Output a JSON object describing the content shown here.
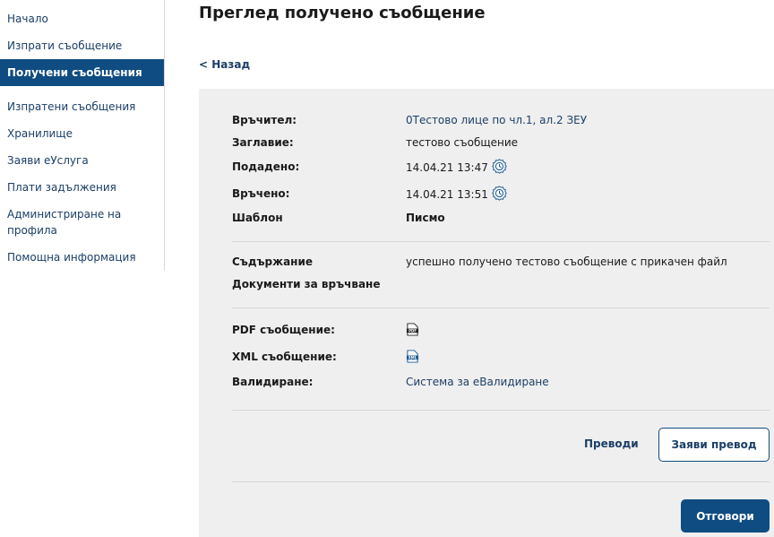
{
  "sidebar": {
    "items": [
      {
        "label": "Начало"
      },
      {
        "label": "Изпрати съобщение"
      },
      {
        "label": "Получени съобщения"
      },
      {
        "label": "Изпратени съобщения"
      },
      {
        "label": "Хранилище"
      },
      {
        "label": "Заяви еУслуга"
      },
      {
        "label": "Плати задължения"
      },
      {
        "label": "Администриране на профила"
      },
      {
        "label": "Помощна информация"
      }
    ],
    "admin_line1": "Администриране на",
    "admin_line2": "профила"
  },
  "header": {
    "title": "Преглед получено съобщение",
    "back": "< Назад"
  },
  "message": {
    "sender_label": "Връчител:",
    "sender_value": "0Тестово лице по чл.1, ал.2 ЗЕУ",
    "subject_label": "Заглавие:",
    "subject_value": "тестово съобщение",
    "submitted_label": "Подадено:",
    "submitted_value": "14.04.21 13:47",
    "delivered_label": "Връчено:",
    "delivered_value": "14.04.21 13:51",
    "template_label": "Шаблон",
    "template_value": "Писмо",
    "content_label": "Съдържание",
    "content_value": "успешно получено тестово съобщение с прикачен файл",
    "documents_label": "Документи за връчване",
    "pdf_label": "PDF съобщение:",
    "xml_label": "XML съобщение:",
    "validation_label": "Валидиране:",
    "validation_value": "Система за еВалидиране"
  },
  "icons": {
    "clock": "timestamp-clock-icon",
    "pdf": "pdf-file-icon",
    "xml": "xml-file-icon"
  },
  "actions": {
    "translations": "Преводи",
    "request_translation": "Заяви превод",
    "reply": "Отговори"
  },
  "colors": {
    "primary": "#0f4c81",
    "link": "#1b3f66",
    "panel_bg": "#efefef"
  }
}
